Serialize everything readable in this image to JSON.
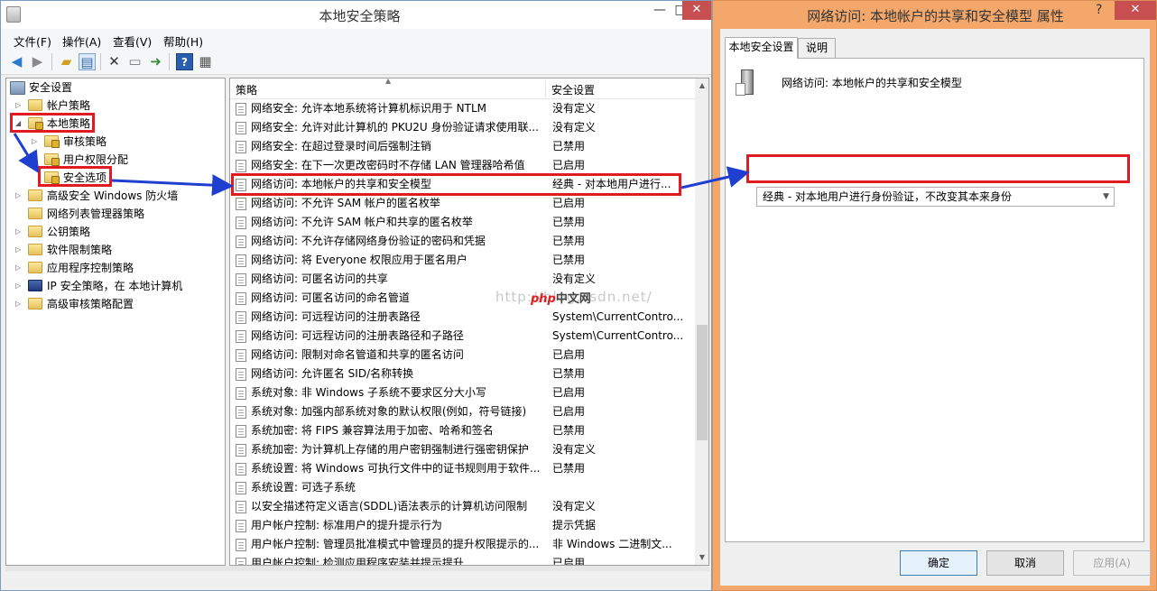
{
  "main_window": {
    "title": "本地安全策略",
    "menu": [
      "文件(F)",
      "操作(A)",
      "查看(V)",
      "帮助(H)"
    ],
    "toolbar_icons": [
      "back-icon",
      "forward-icon",
      "up-folder-icon",
      "show-hide-tree-icon",
      "delete-icon",
      "properties-icon",
      "export-icon",
      "help-icon",
      "view-icon"
    ]
  },
  "tree": {
    "root": "安全设置",
    "items": [
      {
        "label": "帐户策略"
      },
      {
        "label": "本地策略"
      },
      {
        "label": "审核策略"
      },
      {
        "label": "用户权限分配"
      },
      {
        "label": "安全选项"
      },
      {
        "label": "高级安全 Windows 防火墙"
      },
      {
        "label": "网络列表管理器策略"
      },
      {
        "label": "公钥策略"
      },
      {
        "label": "软件限制策略"
      },
      {
        "label": "应用程序控制策略"
      },
      {
        "label": "IP 安全策略，在 本地计算机"
      },
      {
        "label": "高级审核策略配置"
      }
    ]
  },
  "list": {
    "columns": [
      "策略",
      "安全设置"
    ],
    "rows": [
      {
        "policy": "网络安全: 允许本地系统将计算机标识用于 NTLM",
        "setting": "没有定义"
      },
      {
        "policy": "网络安全: 允许对此计算机的 PKU2U 身份验证请求使用联...",
        "setting": "没有定义"
      },
      {
        "policy": "网络安全: 在超过登录时间后强制注销",
        "setting": "已禁用"
      },
      {
        "policy": "网络安全: 在下一次更改密码时不存储 LAN 管理器哈希值",
        "setting": "已启用"
      },
      {
        "policy": "网络访问: 本地帐户的共享和安全模型",
        "setting": "经典 - 对本地用户进行..."
      },
      {
        "policy": "网络访问: 不允许 SAM 帐户的匿名枚举",
        "setting": "已启用"
      },
      {
        "policy": "网络访问: 不允许 SAM 帐户和共享的匿名枚举",
        "setting": "已禁用"
      },
      {
        "policy": "网络访问: 不允许存储网络身份验证的密码和凭据",
        "setting": "已禁用"
      },
      {
        "policy": "网络访问: 将 Everyone 权限应用于匿名用户",
        "setting": "已禁用"
      },
      {
        "policy": "网络访问: 可匿名访问的共享",
        "setting": "没有定义"
      },
      {
        "policy": "网络访问: 可匿名访问的命名管道",
        "setting": ""
      },
      {
        "policy": "网络访问: 可远程访问的注册表路径",
        "setting": "System\\CurrentContro..."
      },
      {
        "policy": "网络访问: 可远程访问的注册表路径和子路径",
        "setting": "System\\CurrentContro..."
      },
      {
        "policy": "网络访问: 限制对命名管道和共享的匿名访问",
        "setting": "已启用"
      },
      {
        "policy": "网络访问: 允许匿名 SID/名称转换",
        "setting": "已禁用"
      },
      {
        "policy": "系统对象: 非 Windows 子系统不要求区分大小写",
        "setting": "已启用"
      },
      {
        "policy": "系统对象: 加强内部系统对象的默认权限(例如，符号链接)",
        "setting": "已启用"
      },
      {
        "policy": "系统加密: 将 FIPS 兼容算法用于加密、哈希和签名",
        "setting": "已禁用"
      },
      {
        "policy": "系统加密: 为计算机上存储的用户密钥强制进行强密钥保护",
        "setting": "没有定义"
      },
      {
        "policy": "系统设置: 将 Windows 可执行文件中的证书规则用于软件...",
        "setting": "已禁用"
      },
      {
        "policy": "系统设置: 可选子系统",
        "setting": ""
      },
      {
        "policy": "以安全描述符定义语言(SDDL)语法表示的计算机访问限制",
        "setting": "没有定义"
      },
      {
        "policy": "用户帐户控制: 标准用户的提升提示行为",
        "setting": "提示凭据"
      },
      {
        "policy": "用户帐户控制: 管理员批准模式中管理员的提升权限提示的...",
        "setting": "非 Windows 二进制文..."
      },
      {
        "policy": "用户帐户控制: 检测应用程序安装并提示提升",
        "setting": "已启用"
      }
    ]
  },
  "watermark": {
    "url_text": "http://blog.csdn.net/",
    "logo_php": "php",
    "logo_text": "中文网"
  },
  "dialog": {
    "title": "网络访问: 本地帐户的共享和安全模型 属性",
    "help_glyph": "?",
    "tabs": [
      "本地安全设置",
      "说明"
    ],
    "policy_name": "网络访问: 本地帐户的共享和安全模型",
    "selected_option": "经典 - 对本地用户进行身份验证，不改变其本来身份",
    "buttons": {
      "ok": "确定",
      "cancel": "取消",
      "apply": "应用(A)"
    }
  },
  "colors": {
    "highlight_box": "#e21b22",
    "annotation_arrow": "#1f3fd0",
    "dialog_frame": "#f3a76a"
  }
}
